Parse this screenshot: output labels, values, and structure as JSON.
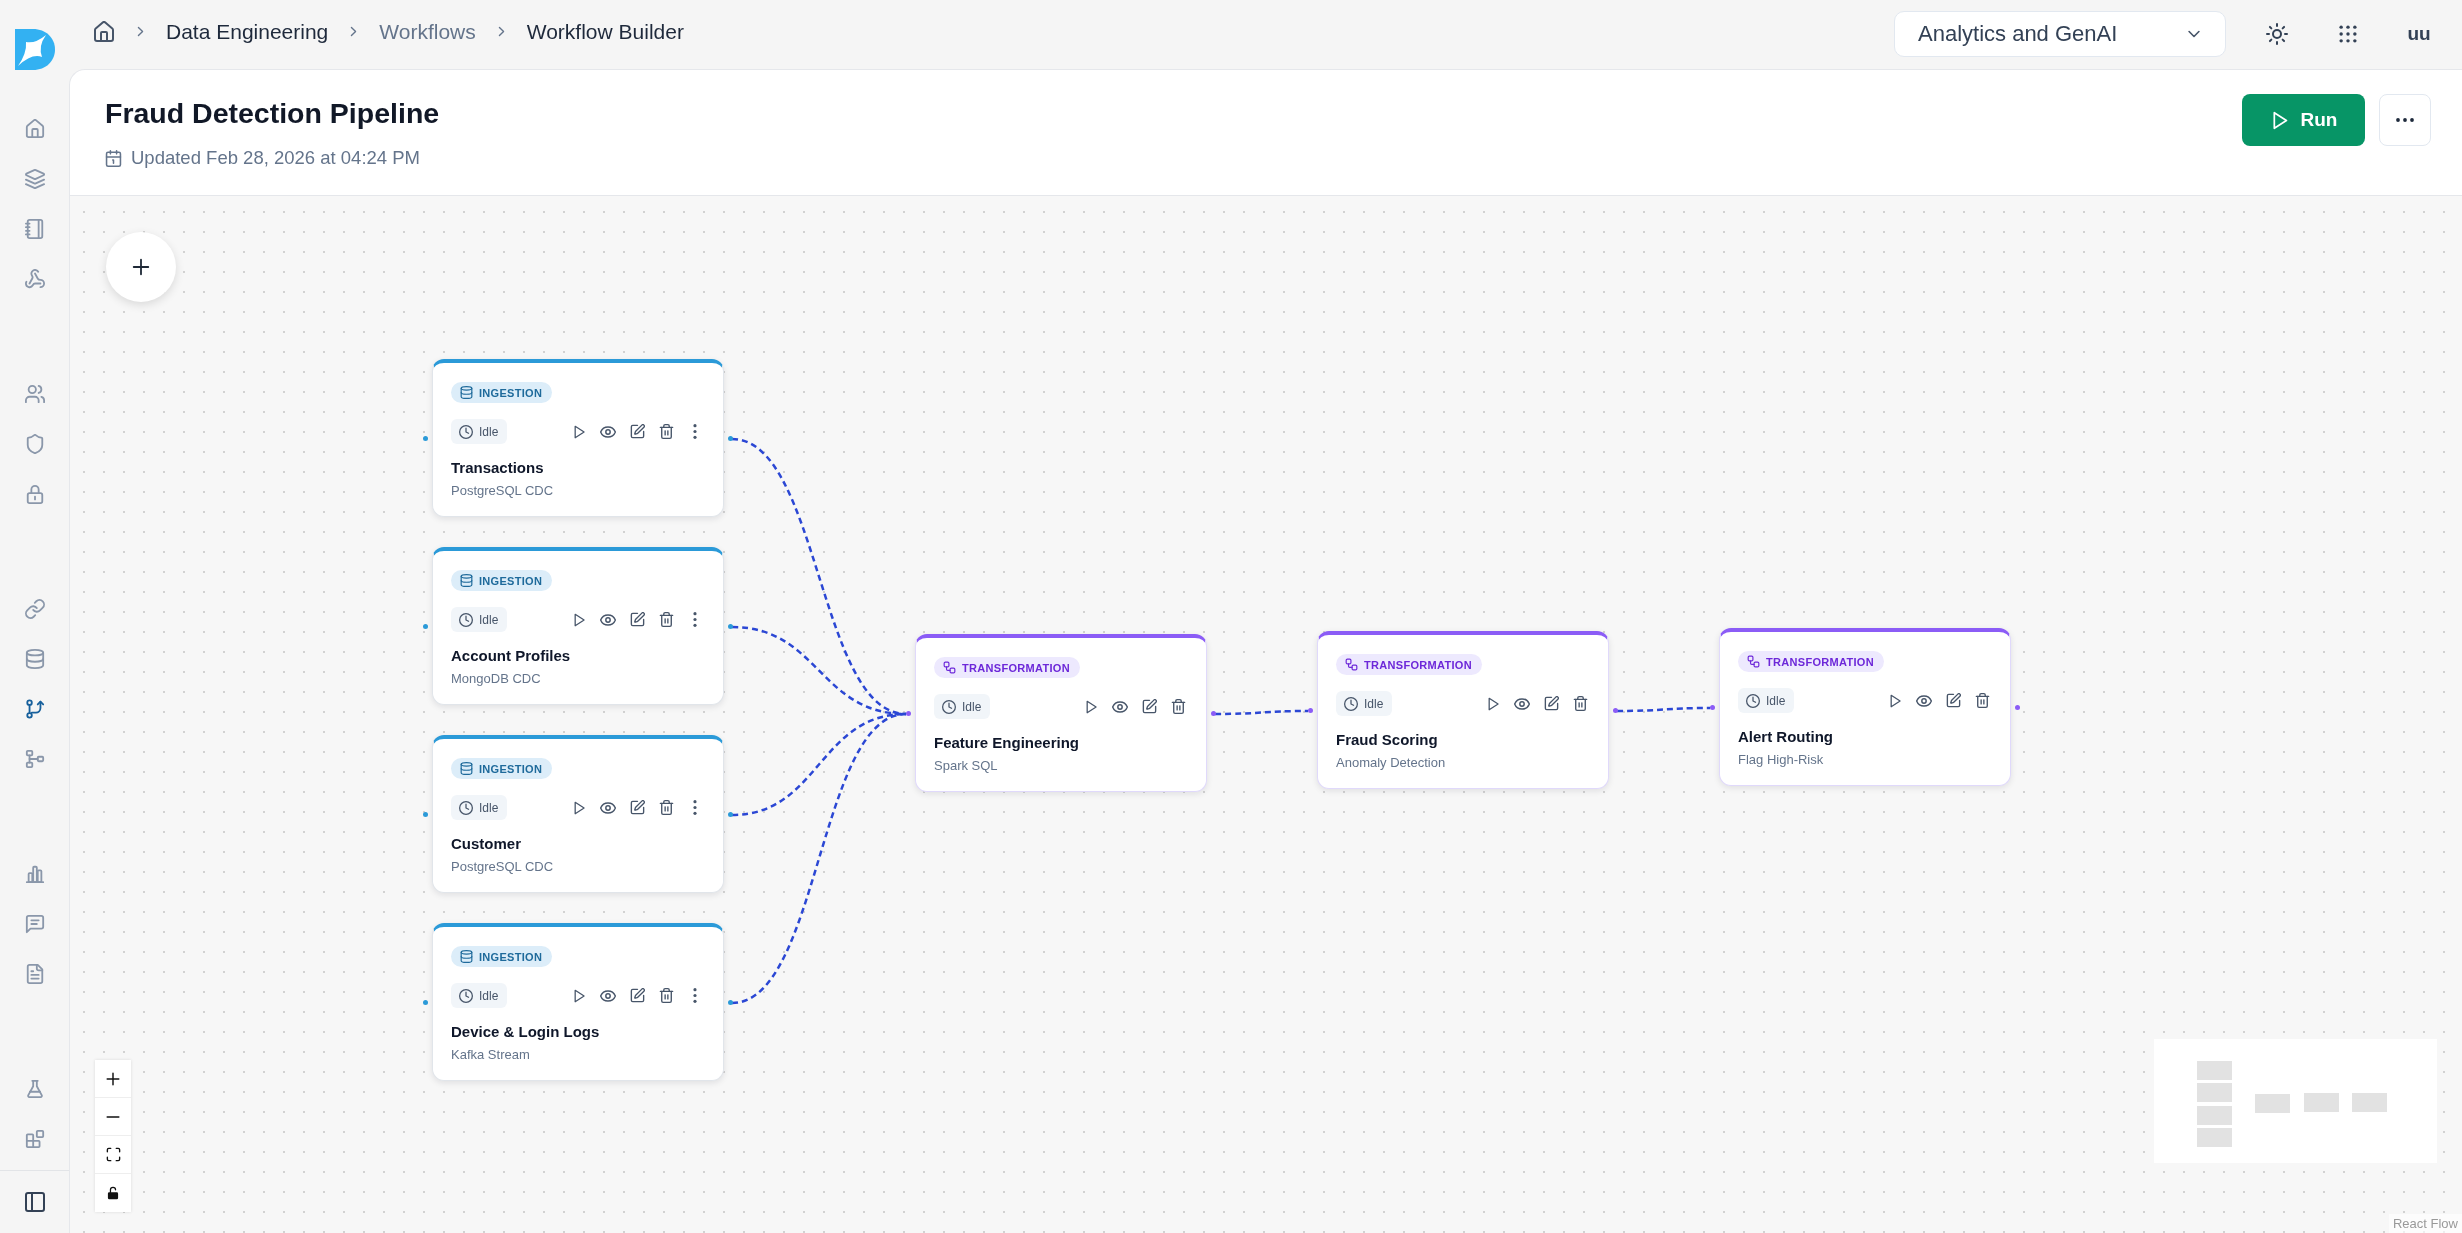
{
  "sidebar": {
    "groups": [
      {
        "items": [
          {
            "selected": false
          },
          {
            "selected": false
          },
          {
            "selected": false
          },
          {
            "selected": false
          }
        ]
      },
      {
        "items": [
          {
            "selected": false
          },
          {
            "selected": false
          },
          {
            "selected": false
          }
        ]
      },
      {
        "items": [
          {
            "selected": false
          },
          {
            "selected": false
          },
          {
            "selected": true
          },
          {
            "selected": false
          }
        ]
      },
      {
        "items": [
          {
            "selected": false
          },
          {
            "selected": false
          },
          {
            "selected": false
          }
        ]
      },
      {
        "items": [
          {
            "selected": false
          },
          {
            "selected": false
          }
        ]
      }
    ]
  },
  "breadcrumb": [
    {
      "label": "Data Engineering",
      "muted": false
    },
    {
      "label": "Workflows",
      "muted": true
    },
    {
      "label": "Workflow Builder",
      "muted": false
    }
  ],
  "workspace_selector": {
    "value": "Analytics and GenAI"
  },
  "user": {
    "initials": "uu"
  },
  "header": {
    "title": "Fraud Detection Pipeline",
    "updated": "Updated Feb 28, 2026 at 04:24 PM",
    "run_button": "Run"
  },
  "canvas": {
    "sources": [
      {
        "kind": "ingestion",
        "category": "INGESTION",
        "status": "Idle",
        "title": "Transactions",
        "subtitle": "PostgreSQL CDC",
        "menu": true
      },
      {
        "kind": "ingestion",
        "category": "INGESTION",
        "status": "Idle",
        "title": "Account Profiles",
        "subtitle": "MongoDB CDC",
        "menu": true
      },
      {
        "kind": "ingestion",
        "category": "INGESTION",
        "status": "Idle",
        "title": "Customer",
        "subtitle": "PostgreSQL CDC",
        "menu": true
      },
      {
        "kind": "ingestion",
        "category": "INGESTION",
        "status": "Idle",
        "title": "Device & Login Logs",
        "subtitle": "Kafka Stream",
        "menu": true
      }
    ],
    "chain": [
      {
        "kind": "transformation",
        "category": "TRANSFORMATION",
        "status": "Idle",
        "title": "Feature Engineering",
        "subtitle": "Spark SQL",
        "menu": false
      },
      {
        "kind": "transformation",
        "category": "TRANSFORMATION",
        "status": "Idle",
        "title": "Fraud Scoring",
        "subtitle": "Anomaly Detection",
        "menu": false
      },
      {
        "kind": "transformation",
        "category": "TRANSFORMATION",
        "status": "Idle",
        "title": "Alert Routing",
        "subtitle": "Flag High-Risk",
        "menu": false
      }
    ],
    "attribution": "React Flow"
  }
}
